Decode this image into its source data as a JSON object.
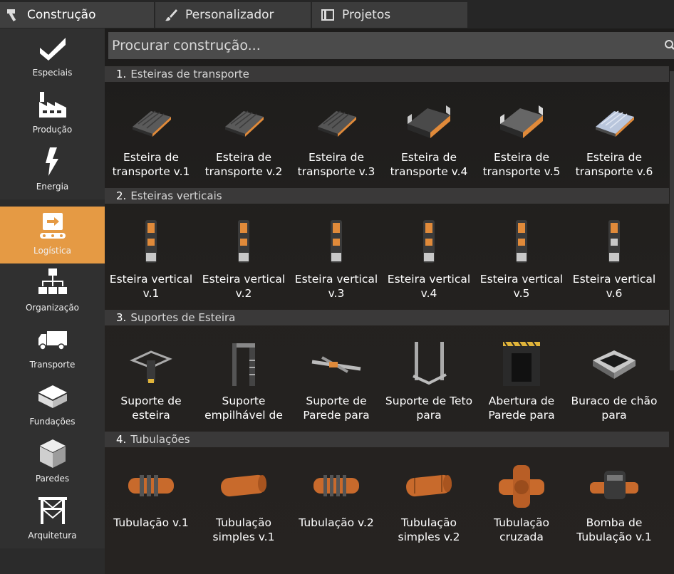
{
  "tabs": [
    {
      "label": "Construção",
      "icon": "hammer-icon"
    },
    {
      "label": "Personalizador",
      "icon": "paintbrush-icon"
    },
    {
      "label": "Projetos",
      "icon": "blueprint-icon"
    }
  ],
  "sidebar": {
    "items": [
      {
        "label": "Especiais",
        "icon": "checkmark-icon"
      },
      {
        "label": "Produção",
        "icon": "factory-icon"
      },
      {
        "label": "Energia",
        "icon": "lightning-icon"
      },
      {
        "label": "Logística",
        "icon": "conveyor-icon"
      },
      {
        "label": "Organização",
        "icon": "hierarchy-icon"
      },
      {
        "label": "Transporte",
        "icon": "truck-icon"
      },
      {
        "label": "Fundações",
        "icon": "foundation-icon"
      },
      {
        "label": "Paredes",
        "icon": "wall-cube-icon"
      },
      {
        "label": "Arquitetura",
        "icon": "scaffold-icon"
      }
    ]
  },
  "search": {
    "placeholder": "Procurar construção..."
  },
  "sections": [
    {
      "num": "1.",
      "title": "Esteiras de transporte",
      "items": [
        {
          "label": "Esteira de transporte v.1",
          "icon": "conveyor-belt-icon"
        },
        {
          "label": "Esteira de transporte v.2",
          "icon": "conveyor-belt-icon"
        },
        {
          "label": "Esteira de transporte v.3",
          "icon": "conveyor-belt-icon"
        },
        {
          "label": "Esteira de transporte v.4",
          "icon": "conveyor-belt-icon"
        },
        {
          "label": "Esteira de transporte v.5",
          "icon": "conveyor-belt-icon"
        },
        {
          "label": "Esteira de transporte v.6",
          "icon": "conveyor-belt-icon"
        }
      ]
    },
    {
      "num": "2.",
      "title": "Esteiras verticais",
      "items": [
        {
          "label": "Esteira vertical v.1",
          "icon": "conveyor-lift-icon"
        },
        {
          "label": "Esteira vertical v.2",
          "icon": "conveyor-lift-icon"
        },
        {
          "label": "Esteira vertical v.3",
          "icon": "conveyor-lift-icon"
        },
        {
          "label": "Esteira vertical v.4",
          "icon": "conveyor-lift-icon"
        },
        {
          "label": "Esteira vertical v.5",
          "icon": "conveyor-lift-icon"
        },
        {
          "label": "Esteira vertical v.6",
          "icon": "conveyor-lift-icon"
        }
      ]
    },
    {
      "num": "3.",
      "title": "Suportes de Esteira",
      "items": [
        {
          "label": "Suporte de esteira",
          "icon": "conveyor-pole-icon"
        },
        {
          "label": "Suporte empilhável de",
          "icon": "stackable-pole-icon"
        },
        {
          "label": "Suporte de Parede para",
          "icon": "wall-mount-icon"
        },
        {
          "label": "Suporte de Teto para",
          "icon": "ceiling-mount-icon"
        },
        {
          "label": "Abertura de Parede para",
          "icon": "wall-hole-icon"
        },
        {
          "label": "Buraco de chão para",
          "icon": "floor-hole-icon"
        }
      ]
    },
    {
      "num": "4.",
      "title": "Tubulações",
      "items": [
        {
          "label": "Tubulação v.1",
          "icon": "pipe-ribbed-icon"
        },
        {
          "label": "Tubulação simples v.1",
          "icon": "pipe-plain-icon"
        },
        {
          "label": "Tubulação v.2",
          "icon": "pipe-ribbed-icon"
        },
        {
          "label": "Tubulação simples v.2",
          "icon": "pipe-plain-icon"
        },
        {
          "label": "Tubulação cruzada",
          "icon": "pipe-junction-icon"
        },
        {
          "label": "Bomba de Tubulação v.1",
          "icon": "pipe-pump-icon"
        }
      ]
    }
  ],
  "colors": {
    "accent": "#e59a44",
    "panel": "#303030",
    "section": "#3a3939"
  }
}
